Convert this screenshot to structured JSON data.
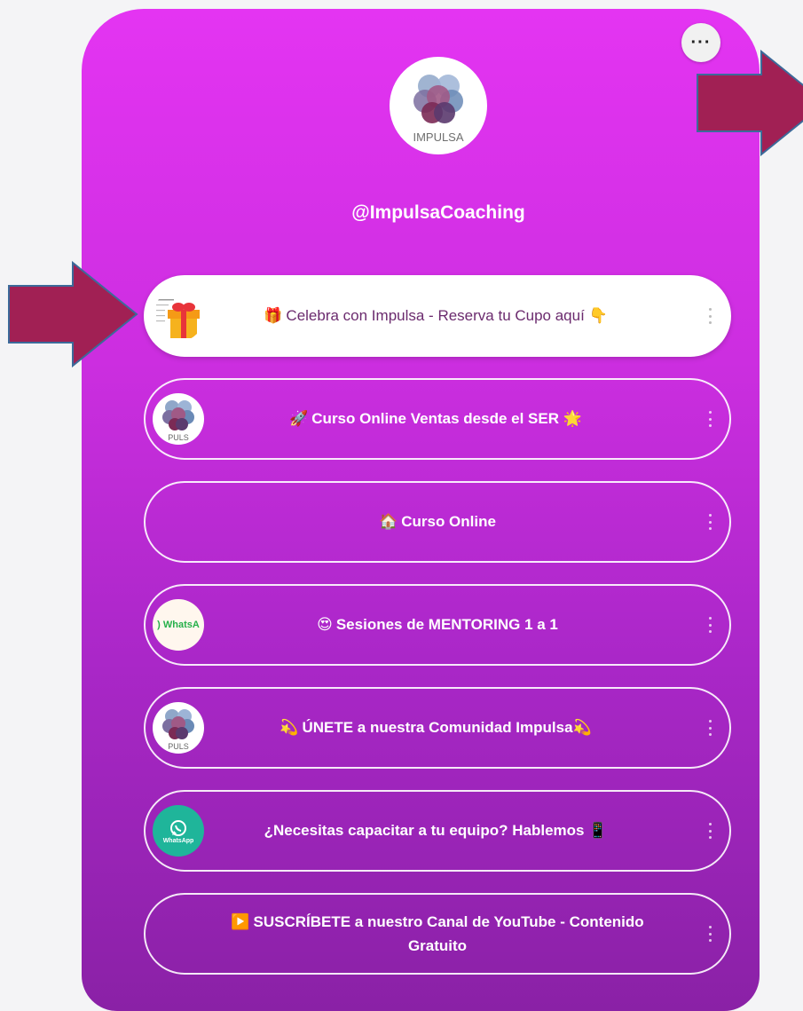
{
  "profile": {
    "handle": "@ImpulsaCoaching",
    "logo_text": "IMPULSA",
    "more_label": "···"
  },
  "links": [
    {
      "text": "Celebra con Impulsa - Reserva tu Cupo aquí",
      "emoji_before": "🎁",
      "emoji_after": "👇",
      "thumb": "gift-icon"
    },
    {
      "text": "Curso Online Ventas desde el SER",
      "emoji_before": "🚀",
      "emoji_after": "🌟",
      "thumb": "impulsa-logo"
    },
    {
      "text": "Curso Online",
      "emoji_before": "🏠",
      "emoji_after": "",
      "thumb": ""
    },
    {
      "text": "Sesiones de MENTORING 1 a 1",
      "emoji_before": "😍",
      "emoji_after": "",
      "thumb": "whatsapp-text",
      "thumb_text": ") WhatsA"
    },
    {
      "text": "ÚNETE a nuestra Comunidad Impulsa",
      "emoji_before": "💫",
      "emoji_after": "💫",
      "thumb": "impulsa-logo"
    },
    {
      "text": "¿Necesitas capacitar a tu equipo? Hablemos",
      "emoji_before": "",
      "emoji_after": "📱",
      "thumb": "whatsapp-icon",
      "thumb_text": "WhatsApp"
    },
    {
      "text_line1": "SUSCRÍBETE a nuestro Canal de YouTube - Contenido",
      "text_line2": "Gratuito",
      "emoji_before": "▶️",
      "emoji_after": "",
      "thumb": ""
    }
  ],
  "colors": {
    "gradient_top": "#e434f2",
    "gradient_bottom": "#8a21a6",
    "arrow": "#a12054",
    "arrow_outline": "#3c6a9a"
  }
}
